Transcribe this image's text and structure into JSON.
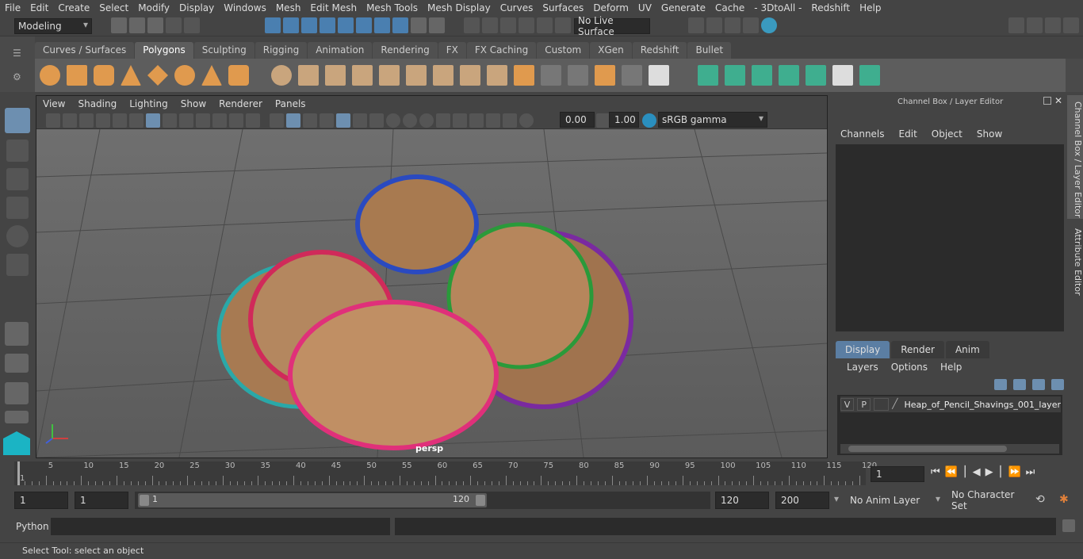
{
  "menubar": [
    "File",
    "Edit",
    "Create",
    "Select",
    "Modify",
    "Display",
    "Windows",
    "Mesh",
    "Edit Mesh",
    "Mesh Tools",
    "Mesh Display",
    "Curves",
    "Surfaces",
    "Deform",
    "UV",
    "Generate",
    "Cache",
    "- 3DtoAll -",
    "Redshift",
    "Help"
  ],
  "status": {
    "mode": "Modeling",
    "live_surface": "No Live Surface"
  },
  "shelf_tabs": [
    "Curves / Surfaces",
    "Polygons",
    "Sculpting",
    "Rigging",
    "Animation",
    "Rendering",
    "FX",
    "FX Caching",
    "Custom",
    "XGen",
    "Redshift",
    "Bullet"
  ],
  "shelf_active": "Polygons",
  "viewport": {
    "menu": [
      "View",
      "Shading",
      "Lighting",
      "Show",
      "Renderer",
      "Panels"
    ],
    "exposure": "0.00",
    "gamma": "1.00",
    "color_space": "sRGB gamma",
    "camera_label": "persp"
  },
  "channel_box": {
    "title": "Channel Box / Layer Editor",
    "menu": [
      "Channels",
      "Edit",
      "Object",
      "Show"
    ]
  },
  "layer_editor": {
    "tabs": [
      "Display",
      "Render",
      "Anim"
    ],
    "active_tab": "Display",
    "menu": [
      "Layers",
      "Options",
      "Help"
    ],
    "layer": {
      "v": "V",
      "p": "P",
      "name": "Heap_of_Pencil_Shavings_001_layer"
    }
  },
  "side_tabs": [
    "Channel Box / Layer Editor",
    "Attribute Editor"
  ],
  "timeline": {
    "ticks": [
      "1",
      "5",
      "10",
      "15",
      "20",
      "25",
      "30",
      "35",
      "40",
      "45",
      "50",
      "55",
      "60",
      "65",
      "70",
      "75",
      "80",
      "85",
      "90",
      "95",
      "100",
      "105",
      "110",
      "115",
      "120"
    ],
    "current_frame": "1"
  },
  "range": {
    "start": "1",
    "playback_start": "1",
    "slider_start": "1",
    "slider_end": "120",
    "playback_end": "120",
    "end": "200",
    "anim_layer": "No Anim Layer",
    "character_set": "No Character Set"
  },
  "cmdline": {
    "label": "Python"
  },
  "help_line": "Select Tool: select an object"
}
